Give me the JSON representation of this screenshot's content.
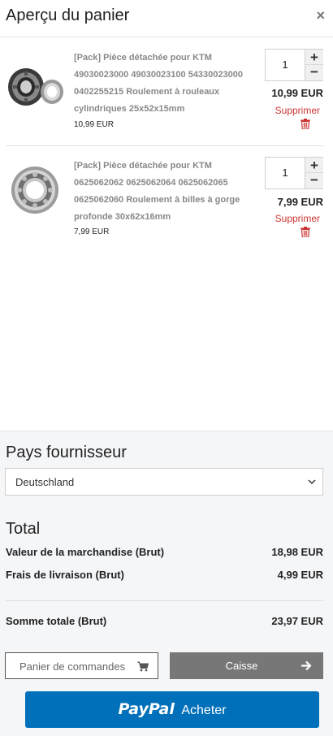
{
  "header": {
    "title": "Aperçu du panier",
    "close_glyph": "×"
  },
  "items": [
    {
      "description": "[Pack] Pièce détachée pour KTM 49030023000 49030023100 54330023000 0402255215 Roulement à rouleaux cylindriques 25x52x15mm",
      "unit_price": "10,99 EUR",
      "quantity": "1",
      "line_total": "10,99 EUR",
      "remove_label": "Supprimer",
      "image_icon": "cylindrical-roller-bearing-image"
    },
    {
      "description": "[Pack] Pièce détachée pour KTM 0625062062 0625062064 0625062065 0625062060 Roulement à billes à gorge profonde 30x62x16mm",
      "unit_price": "7,99 EUR",
      "quantity": "1",
      "line_total": "7,99 EUR",
      "remove_label": "Supprimer",
      "image_icon": "ball-bearing-image"
    }
  ],
  "qty_controls": {
    "plus": "+",
    "minus": "−"
  },
  "supplier": {
    "title": "Pays fournisseur",
    "selected": "Deutschland"
  },
  "totals": {
    "title": "Total",
    "goods_label": "Valeur de la marchandise (Brut)",
    "goods_value": "18,98 EUR",
    "shipping_label": "Frais de livraison (Brut)",
    "shipping_value": "4,99 EUR",
    "sum_label": "Somme totale (Brut)",
    "sum_value": "23,97 EUR"
  },
  "buttons": {
    "cart_label": "Panier de commandes",
    "checkout_label": "Caisse",
    "paypal_logo": "PayPal",
    "paypal_label": "Acheter"
  },
  "colors": {
    "accent_remove": "#cc3333",
    "paypal_blue": "#0070ba",
    "checkout_gray": "#777777"
  }
}
